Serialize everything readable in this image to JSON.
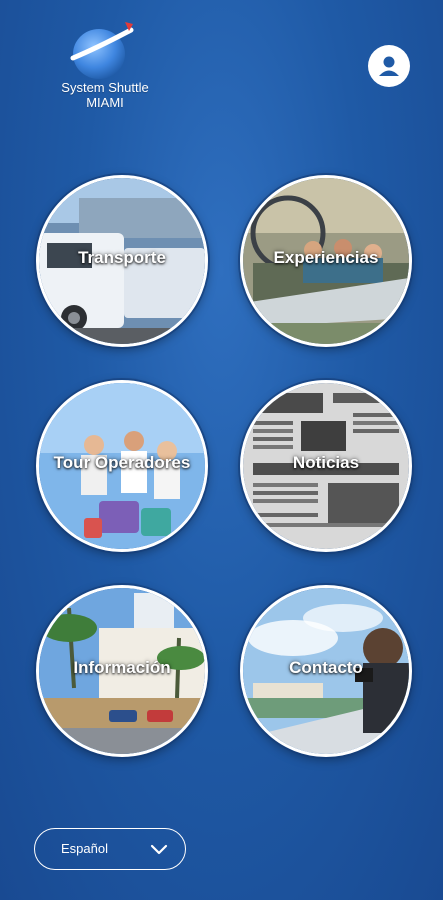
{
  "brand": {
    "line1": "System Shuttle",
    "line2": "MIAMI"
  },
  "profile": {
    "icon": "user-icon"
  },
  "menu": [
    {
      "id": "transporte",
      "label": "Transporte"
    },
    {
      "id": "experiencias",
      "label": "Experiencias"
    },
    {
      "id": "tour-operadores",
      "label": "Tour Operadores"
    },
    {
      "id": "noticias",
      "label": "Noticias"
    },
    {
      "id": "informacion",
      "label": "Información"
    },
    {
      "id": "contacto",
      "label": "Contacto"
    }
  ],
  "language": {
    "selected": "Español",
    "icon": "chevron-down-icon"
  },
  "colors": {
    "background": "#1f5aa6",
    "accent": "#ffffff",
    "logo_red": "#e23b3b"
  }
}
